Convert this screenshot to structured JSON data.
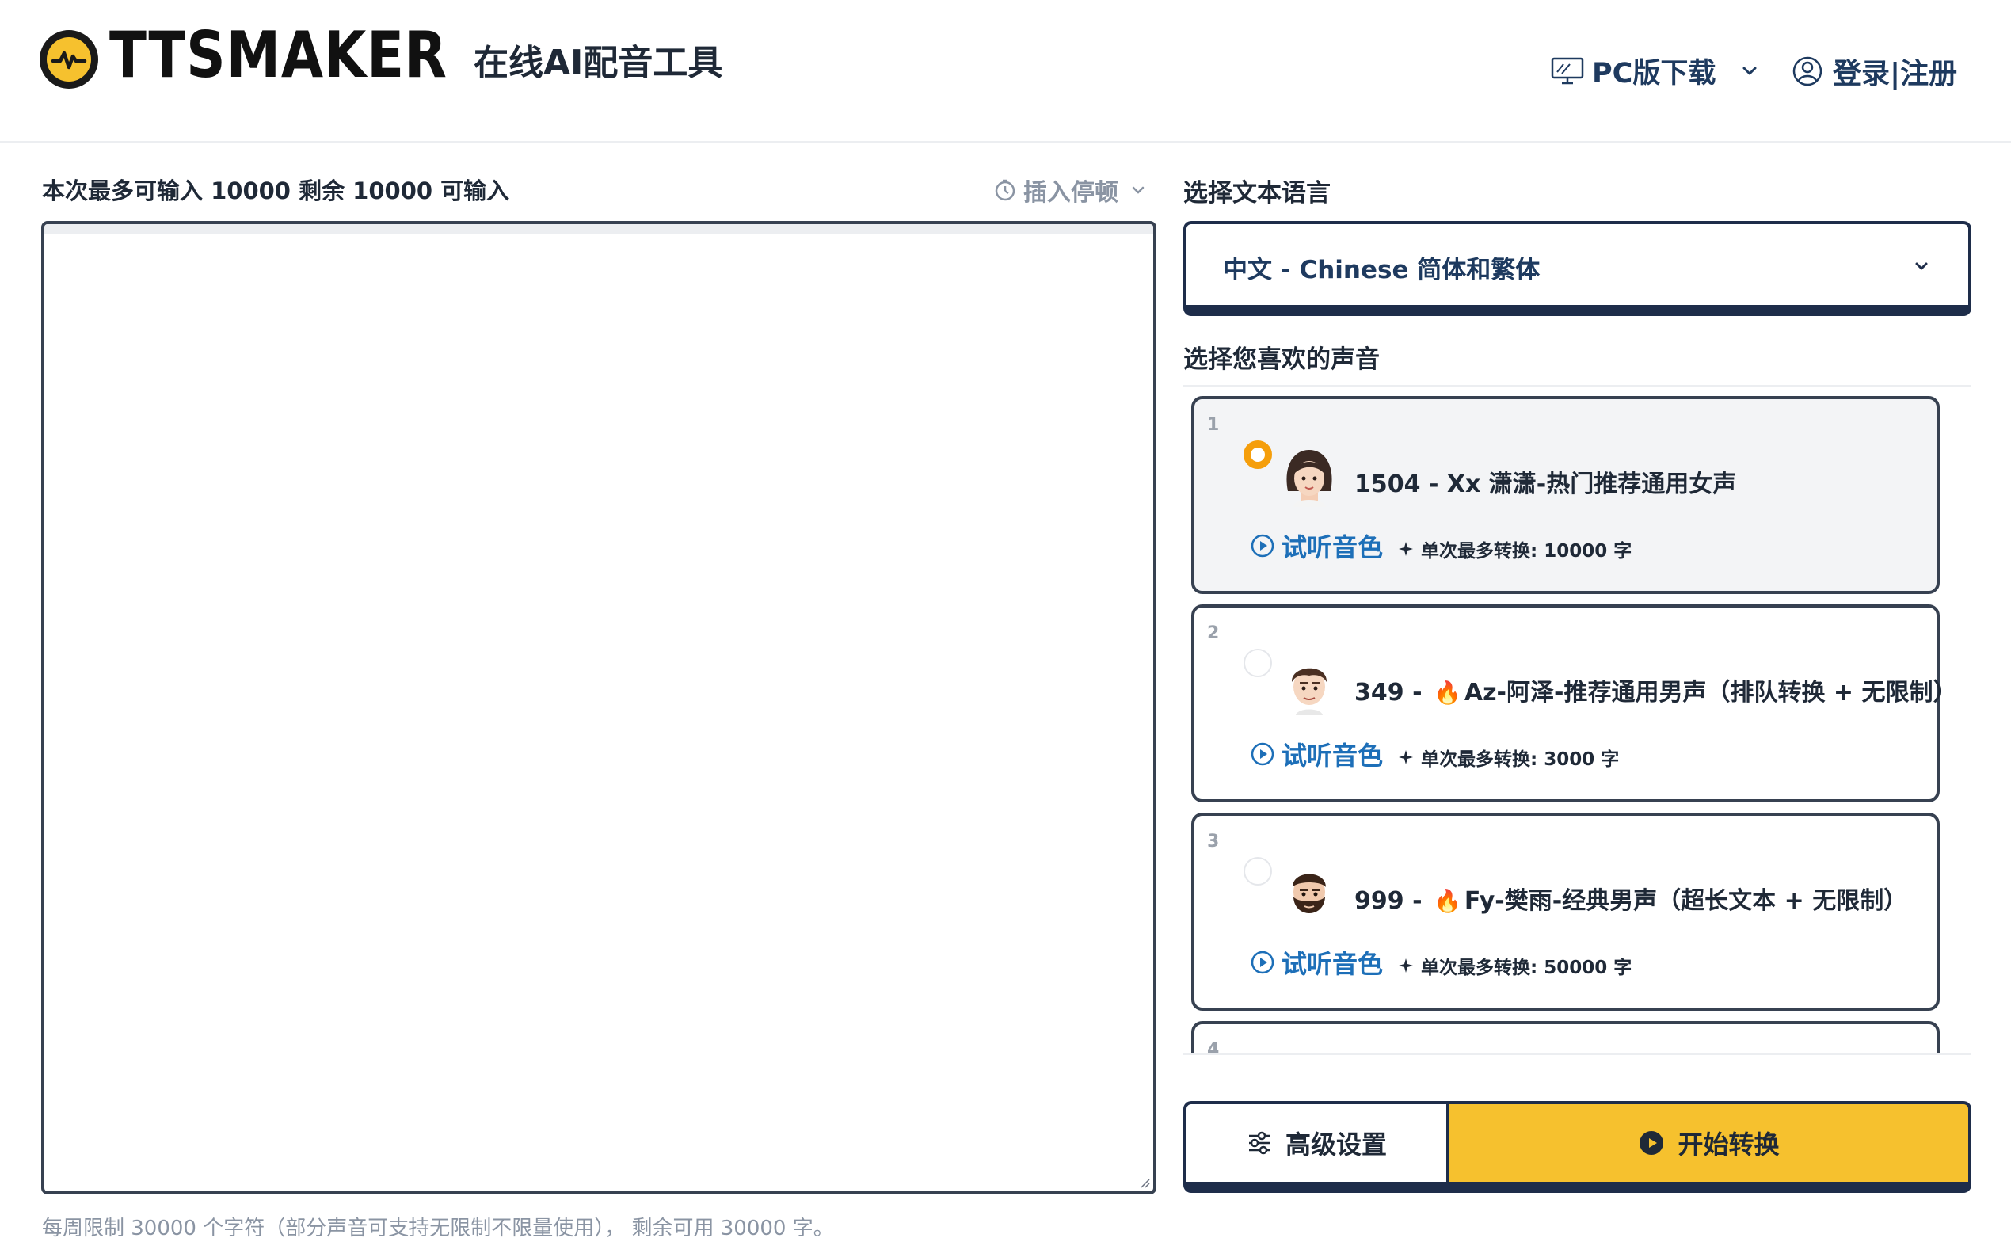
{
  "header": {
    "logo_text": "TTSMAKER",
    "subtitle": "在线AI配音工具",
    "pc_download": "PC版下载",
    "login_register": "登录|注册"
  },
  "editor": {
    "quota_text": "本次最多可输入 10000 剩余 10000 可输入",
    "insert_pause": "插入停顿",
    "text_value": "",
    "footer_note": "每周限制 30000 个字符（部分声音可支持无限制不限量使用）， 剩余可用 30000 字。"
  },
  "language": {
    "label": "选择文本语言",
    "selected": "中文 - Chinese 简体和繁体"
  },
  "voices": {
    "label": "选择您喜欢的声音",
    "preview_label": "试听音色",
    "items": [
      {
        "num": "1",
        "id_prefix": "1504 -",
        "hot": false,
        "name": "Xx 潇潇-热门推荐通用女声",
        "max": "单次最多转换: 10000 字",
        "selected": true
      },
      {
        "num": "2",
        "id_prefix": "349 -",
        "hot": true,
        "name": "Az-阿泽-推荐通用男声（排队转换 + 无限制）",
        "max": "单次最多转换: 3000 字",
        "selected": false
      },
      {
        "num": "3",
        "id_prefix": "999 -",
        "hot": true,
        "name": "Fy-樊雨-经典男声（超长文本 + 无限制）",
        "max": "单次最多转换: 50000 字",
        "selected": false
      },
      {
        "num": "4",
        "id_prefix": "",
        "hot": false,
        "name": "",
        "max": "",
        "selected": false
      }
    ]
  },
  "actions": {
    "advanced": "高级设置",
    "start": "开始转换"
  },
  "colors": {
    "accent_yellow": "#f6c12e",
    "navy": "#1e2d4a",
    "link_blue": "#1d6fb8",
    "radio_orange": "#f59e0b"
  },
  "icons": {
    "pc": "desktop-monitor-icon",
    "user": "user-circle-icon",
    "clock": "clock-icon",
    "play": "play-circle-icon",
    "sparkle": "sparkle-icon",
    "settings": "sliders-icon",
    "fire": "fire-emoji"
  }
}
